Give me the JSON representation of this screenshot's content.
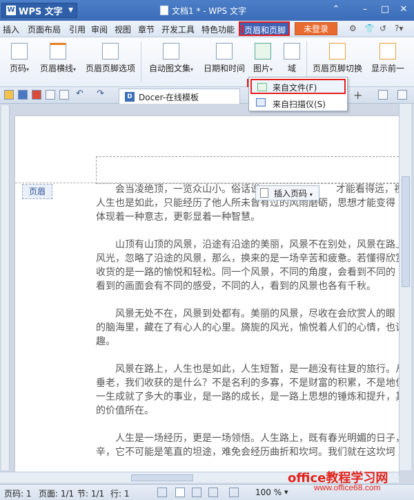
{
  "titlebar": {
    "app_label": "WPS 文字",
    "doc_title": "文档1 * - WPS 文字"
  },
  "menubar": {
    "items": [
      "插入",
      "页面布局",
      "引用",
      "审阅",
      "视图",
      "章节",
      "开发工具",
      "特色功能"
    ],
    "active_item": "页眉和页脚",
    "login": "未登录"
  },
  "ribbon": {
    "buttons": [
      "页码",
      "页眉横线",
      "页眉页脚选项",
      "自动图文集",
      "日期和时间",
      "图片",
      "域",
      "页眉页脚切换",
      "显示前一"
    ]
  },
  "tabs": {
    "docer": "Docer-在线模板"
  },
  "dropdown": {
    "from_file": "来自文件(F)",
    "from_scanner": "来自扫描仪(S)"
  },
  "document": {
    "header_label": "页眉",
    "insert_page_number": "插入页码",
    "paragraphs": [
      [
        "会当凌绝顶，一览众山小。俗话说",
        "人生也是如此，只能经历了他人所未曾有过的风雨磨砺，思想才能变得",
        "体现着一种意志，更彰显着一种智慧。"
      ],
      [
        "山顶有山顶的风景，沿途有沿途的美丽，风景不在别处，风景在路上",
        "风光，忽略了沿途的风景，那么，换来的是一场辛苦和疲惫。若懂得欣赏",
        "收货的是一路的愉悦和轻松。同一个风景，不同的角度，会看到不同的",
        "看到的画面会有不同的感受，不同的人，看到的风景也各有千秋。"
      ],
      [
        "风景无处不在，风景到处都有。美丽的风景，尽收在会欣赏人的眼",
        "的脑海里，藏在了有心人的心里。旖旎的风光，愉悦着人们的心情，也诉",
        "趣。"
      ],
      [
        "风景在路上，人生也是如此，人生短暂，是一趟没有往复的旅行。从",
        "垂老，我们收获的是什么？不是名利的多寡，不是财富的积累，不是地位",
        "一生成就了多大的事业，是一路的成长，是一路上思想的锤炼和提升，其",
        "的价值所在。"
      ],
      [
        "人生是一场经历，更是一场领悟。人生路上，既有春光明媚的日子，",
        "辛，它不可能是笔直的坦途，难免会经历曲折和坎坷。我们就在这坎坷"
      ]
    ],
    "header_trail": "才能看得远，视野"
  },
  "statusbar": {
    "page": "页码: 1",
    "pages": "页面: 1/1",
    "section": "节: 1/1",
    "line": "行: 1",
    "zoom": "100 %"
  },
  "watermark": {
    "site": "office教程学习网",
    "url": "www.office68.com"
  }
}
